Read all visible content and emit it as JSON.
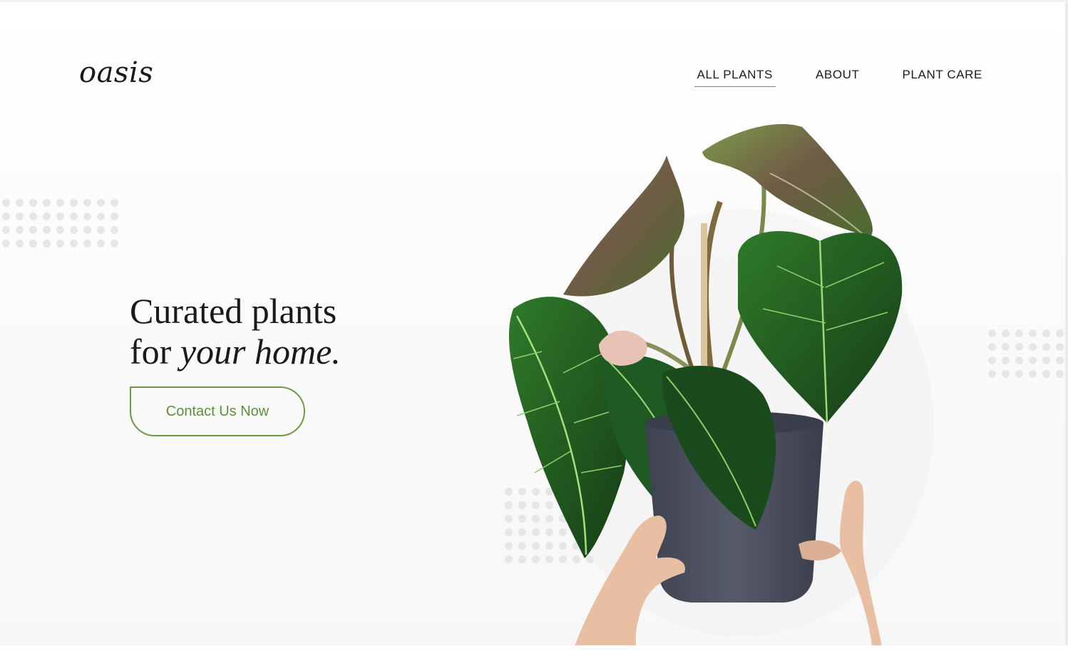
{
  "logo": {
    "text": "oasis"
  },
  "nav": {
    "items": [
      {
        "label": "ALL PLANTS",
        "active": true
      },
      {
        "label": "ABOUT",
        "active": false
      },
      {
        "label": "PLANT CARE",
        "active": false
      }
    ]
  },
  "hero": {
    "line1": "Curated plants",
    "line2_prefix": "for ",
    "line2_emphasis": "your home.",
    "cta_label": "Contact Us Now"
  },
  "colors": {
    "accent": "#6b9a44",
    "text": "#1a1a1a",
    "dot": "#e6e6e6",
    "leaf_dark": "#1f4d1f",
    "leaf_light": "#5aa02c",
    "pot": "#4a4f5c"
  },
  "illustration": {
    "name": "potted-plant-held-by-hands"
  }
}
